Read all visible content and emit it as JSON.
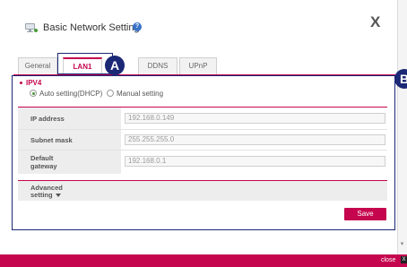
{
  "window": {
    "title": "Basic Network Setting",
    "help_icon": "question-icon",
    "close_label": "X"
  },
  "tabs": [
    {
      "label": "General",
      "active": false
    },
    {
      "label": "LAN1",
      "active": true
    },
    {
      "label": "DDNS",
      "active": false
    },
    {
      "label": "UPnP",
      "active": false
    }
  ],
  "annotations": {
    "badge_a": "A",
    "badge_b": "B"
  },
  "ipv4": {
    "heading": "IPV4",
    "auto_label": "Auto setting(DHCP)",
    "manual_label": "Manual setting",
    "selected": "auto"
  },
  "fields": [
    {
      "label": "IP address",
      "value": "192.168.0.149"
    },
    {
      "label": "Subnet mask",
      "value": "255.255.255.0"
    },
    {
      "label": "Default gateway",
      "label_line1": "Default",
      "label_line2": "gateway",
      "value": "192.168.0.1"
    }
  ],
  "advanced": {
    "line1": "Advanced",
    "line2": "setting"
  },
  "save_label": "Save",
  "bottom": {
    "close_label": "close",
    "close_box": "X"
  },
  "colors": {
    "accent": "#c5064e",
    "annotation": "#1b2875",
    "label_bg": "#ededed"
  }
}
